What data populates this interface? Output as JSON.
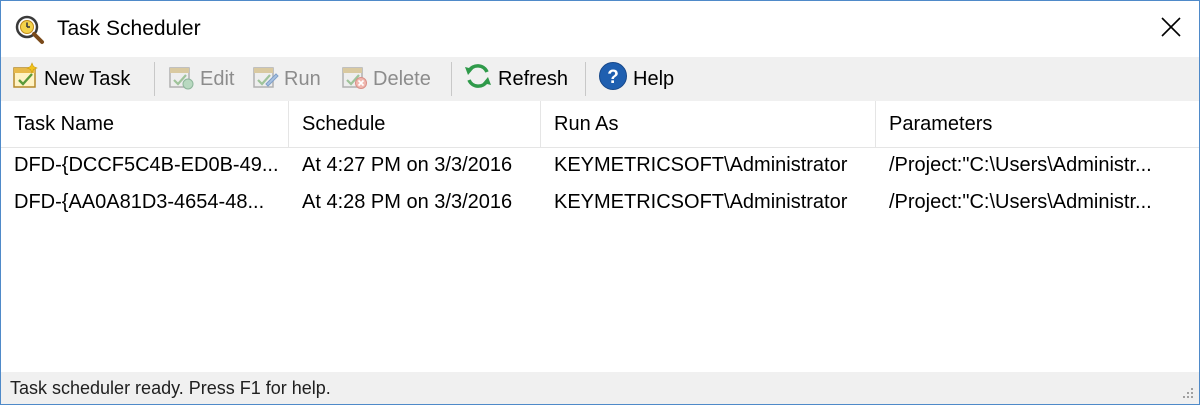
{
  "window": {
    "title": "Task Scheduler",
    "app_icon": "magnifier-clock-icon",
    "close_icon": "close-icon"
  },
  "toolbar": {
    "new_task": {
      "label": "New Task",
      "icon": "new-task-icon"
    },
    "edit": {
      "label": "Edit",
      "icon": "edit-task-icon",
      "enabled": false
    },
    "run": {
      "label": "Run",
      "icon": "run-task-icon",
      "enabled": false
    },
    "delete": {
      "label": "Delete",
      "icon": "delete-task-icon",
      "enabled": false
    },
    "refresh": {
      "label": "Refresh",
      "icon": "refresh-icon"
    },
    "help": {
      "label": "Help",
      "icon": "help-icon"
    }
  },
  "list": {
    "columns": [
      "Task Name",
      "Schedule",
      "Run As",
      "Parameters"
    ],
    "rows": [
      {
        "task_name": "DFD-{DCCF5C4B-ED0B-49...",
        "schedule": "At 4:27 PM on 3/3/2016",
        "run_as": "KEYMETRICSOFT\\Administrator",
        "parameters": "/Project:\"C:\\Users\\Administr..."
      },
      {
        "task_name": "DFD-{AA0A81D3-4654-48...",
        "schedule": "At 4:28 PM on 3/3/2016",
        "run_as": "KEYMETRICSOFT\\Administrator",
        "parameters": "/Project:\"C:\\Users\\Administr..."
      }
    ]
  },
  "statusbar": {
    "text": "Task scheduler ready. Press F1 for help."
  },
  "colors": {
    "window_border": "#4f8ac9",
    "toolbar_bg": "#f0f0f0",
    "disabled_text": "#8c8c8c",
    "refresh_green": "#2f9a4a",
    "help_blue": "#1f5fb0"
  }
}
